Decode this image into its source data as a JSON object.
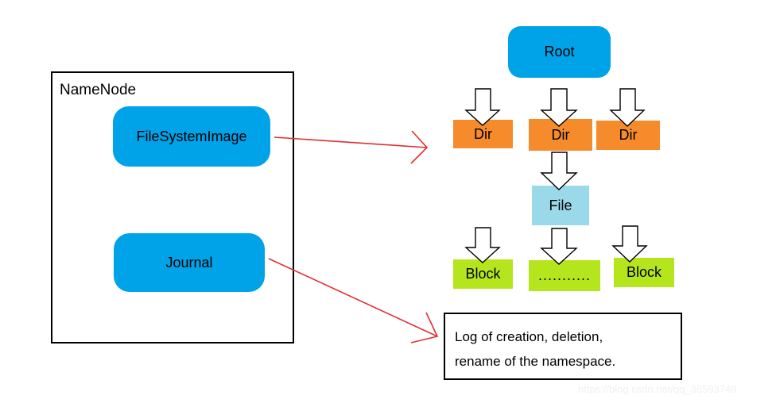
{
  "diagram": {
    "title": "HDFS NameNode metadata diagram",
    "colors": {
      "blue": "#00A2E8",
      "orange": "#F68B2C",
      "green": "#B5E61D",
      "light_blue": "#99D9EA",
      "arrow_red": "#E03030",
      "outline_black": "#000000",
      "background": "#FFFFFF"
    },
    "namenode": {
      "label": "NameNode",
      "components": [
        {
          "label": "FileSystemImage",
          "shape": "rounded-rectangle",
          "color": "#00A2E8"
        },
        {
          "label": "Journal",
          "shape": "rounded-rectangle",
          "color": "#00A2E8"
        }
      ]
    },
    "namespace_tree": {
      "root": {
        "label": "Root",
        "shape": "rounded-rectangle",
        "color": "#00A2E8"
      },
      "dirs": [
        {
          "label": "Dir",
          "shape": "rectangle",
          "color": "#F68B2C"
        },
        {
          "label": "Dir",
          "shape": "rectangle",
          "color": "#F68B2C"
        },
        {
          "label": "Dir",
          "shape": "rectangle",
          "color": "#F68B2C"
        }
      ],
      "file": {
        "label": "File",
        "shape": "rectangle",
        "color": "#99D9EA"
      },
      "blocks": [
        {
          "label": "Block",
          "shape": "rectangle",
          "color": "#B5E61D"
        },
        {
          "label": "...........",
          "shape": "rectangle",
          "color": "#B5E61D"
        },
        {
          "label": "Block",
          "shape": "rectangle",
          "color": "#B5E61D"
        }
      ]
    },
    "log_box": {
      "line1": "Log of creation,  deletion,",
      "line2": "rename of the namespace."
    },
    "connectors": {
      "block_arrow_count": 7,
      "red_arrows": [
        {
          "from": "FileSystemImage",
          "to": "namespace-tree"
        },
        {
          "from": "Journal",
          "to": "log-box"
        }
      ]
    },
    "watermark": "https://blog.csdn.net/qq_36593748"
  }
}
